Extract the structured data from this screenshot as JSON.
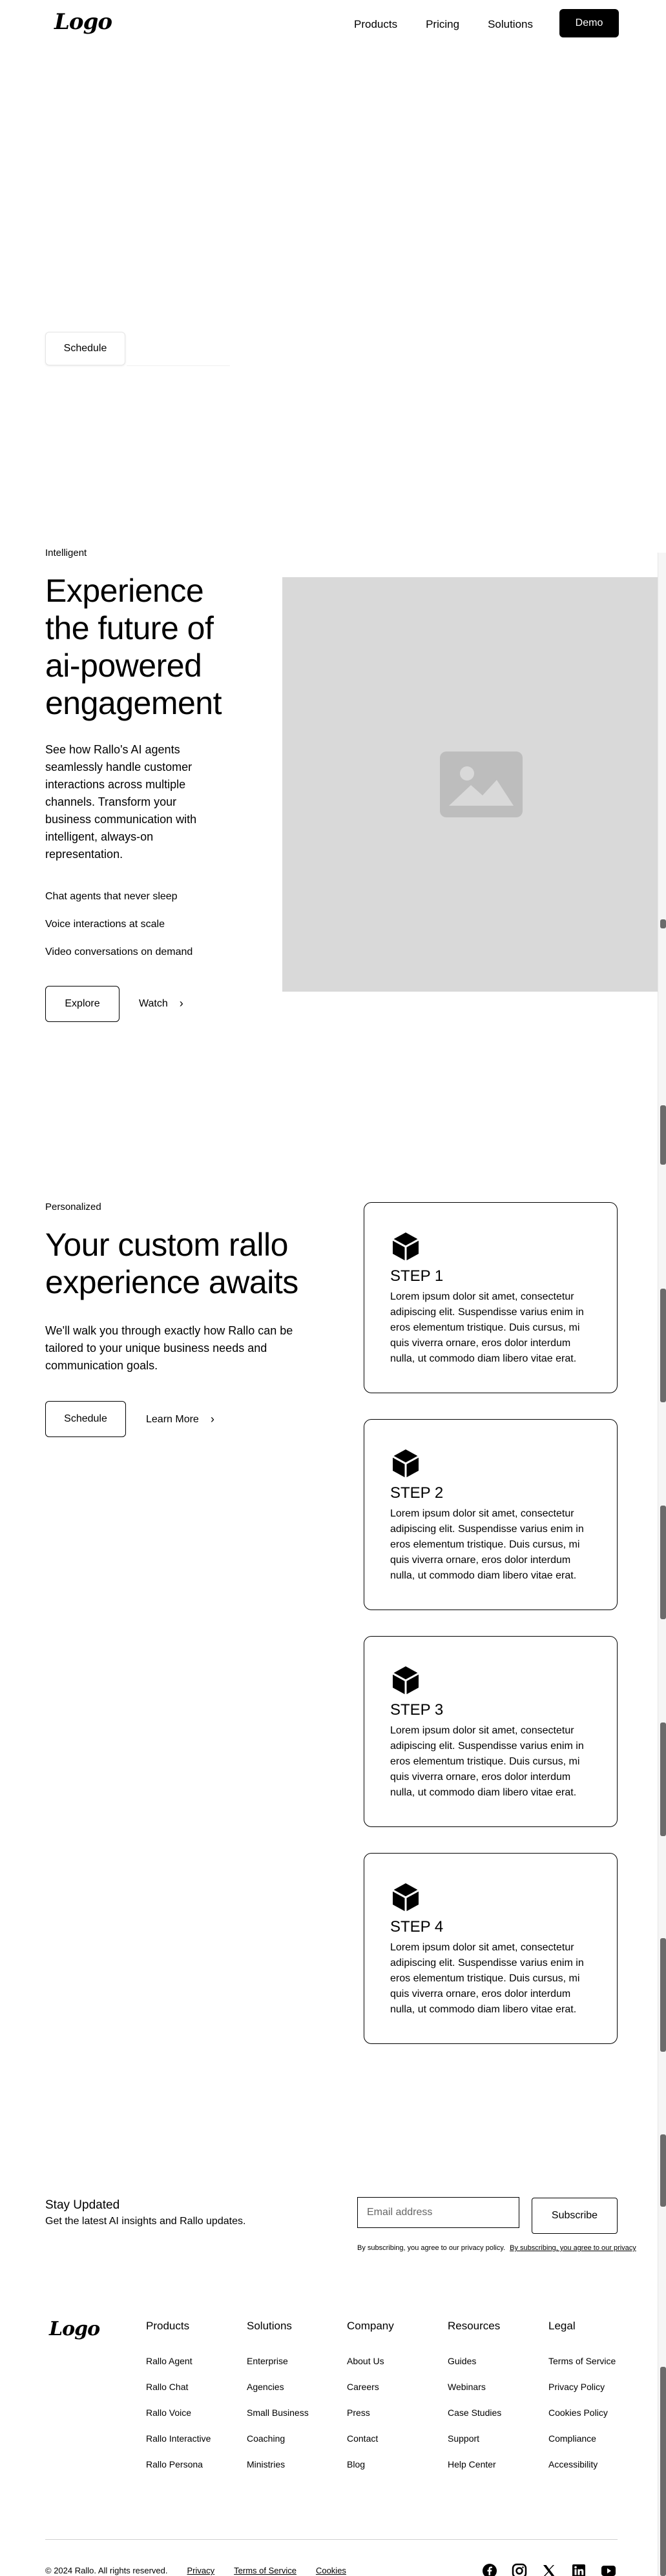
{
  "nav": {
    "logo": "Logo",
    "links": [
      "Products",
      "Pricing",
      "Solutions"
    ],
    "demo": "Demo"
  },
  "hero": {
    "schedule": "Schedule"
  },
  "engage": {
    "tag": "Intelligent",
    "title": "Experience the future of ai-powered engagement",
    "body": "See how Rallo's AI agents seamlessly handle customer interactions across multiple channels. Transform your business communication with intelligent, always-on representation.",
    "features": [
      "Chat agents that never sleep",
      "Voice interactions at scale",
      "Video conversations on demand"
    ],
    "explore": "Explore",
    "watch": "Watch"
  },
  "custom": {
    "tag": "Personalized",
    "title": "Your custom rallo experience awaits",
    "body": "We'll walk you through exactly how Rallo can be tailored to your unique business needs and communication goals.",
    "schedule": "Schedule",
    "learn_more": "Learn More",
    "steps": [
      {
        "title": "STEP 1",
        "text": "Lorem ipsum dolor sit amet, consectetur adipiscing elit. Suspendisse varius enim in eros elementum tristique. Duis cursus, mi quis viverra ornare, eros dolor interdum nulla, ut commodo diam libero vitae erat."
      },
      {
        "title": "STEP 2",
        "text": "Lorem ipsum dolor sit amet, consectetur adipiscing elit. Suspendisse varius enim in eros elementum tristique. Duis cursus, mi quis viverra ornare, eros dolor interdum nulla, ut commodo diam libero vitae erat."
      },
      {
        "title": "STEP 3",
        "text": "Lorem ipsum dolor sit amet, consectetur adipiscing elit. Suspendisse varius enim in eros elementum tristique. Duis cursus, mi quis viverra ornare, eros dolor interdum nulla, ut commodo diam libero vitae erat."
      },
      {
        "title": "STEP 4",
        "text": "Lorem ipsum dolor sit amet, consectetur adipiscing elit. Suspendisse varius enim in eros elementum tristique. Duis cursus, mi quis viverra ornare, eros dolor interdum nulla, ut commodo diam libero vitae erat."
      }
    ]
  },
  "newsletter": {
    "title": "Stay Updated",
    "subtitle": "Get the latest AI insights and Rallo updates.",
    "placeholder": "Email address",
    "subscribe": "Subscribe",
    "consent": "By subscribing, you agree to our privacy policy.",
    "consent_link": "By subscribing, you agree to our privacy"
  },
  "footer": {
    "logo": "Logo",
    "columns": [
      {
        "title": "Products",
        "items": [
          "Rallo Agent",
          "Rallo Chat",
          "Rallo Voice",
          "Rallo Interactive",
          "Rallo Persona"
        ]
      },
      {
        "title": "Solutions",
        "items": [
          "Enterprise",
          "Agencies",
          "Small Business",
          "Coaching",
          "Ministries"
        ]
      },
      {
        "title": "Company",
        "items": [
          "About Us",
          "Careers",
          "Press",
          "Contact",
          "Blog"
        ]
      },
      {
        "title": "Resources",
        "items": [
          "Guides",
          "Webinars",
          "Case Studies",
          "Support",
          "Help Center"
        ]
      },
      {
        "title": "Legal",
        "items": [
          "Terms of Service",
          "Privacy Policy",
          "Cookies Policy",
          "Compliance",
          "Accessibility"
        ]
      }
    ],
    "copyright": "© 2024 Rallo. All rights reserved.",
    "bottom_links": [
      "Privacy",
      "Terms of Service",
      "Cookies"
    ],
    "social_icons": [
      "facebook-icon",
      "instagram-icon",
      "x-icon",
      "linkedin-icon",
      "youtube-icon"
    ]
  }
}
